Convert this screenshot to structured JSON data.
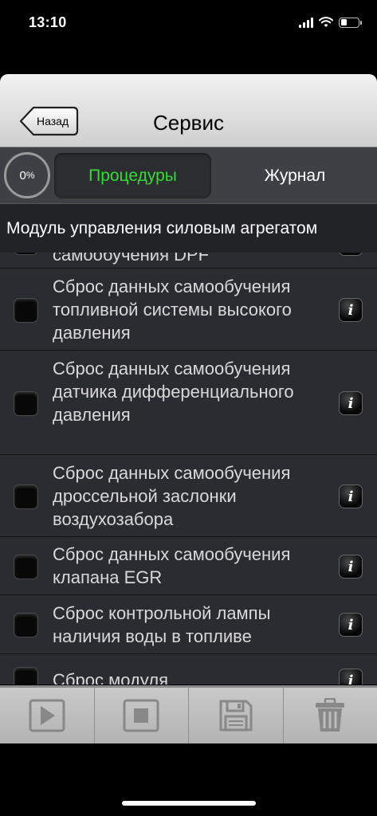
{
  "status": {
    "time": "13:10",
    "battery_level": 0.35
  },
  "nav": {
    "back_label": "Назад",
    "title": "Сервис"
  },
  "segments": {
    "progress_value": "0",
    "progress_unit": "%",
    "active_tab": "Процедуры",
    "other_tab": "Журнал"
  },
  "module_header": "Модуль управления силовым агрегатом",
  "procedures": [
    {
      "label": "самообучения DPF"
    },
    {
      "label": "Сброс данных самообучения топливной системы высокого давления"
    },
    {
      "label": "Сброс данных самообучения датчика дифференциального давления"
    },
    {
      "label": "Сброс данных самообучения дроссельной заслонки воздухозабора"
    },
    {
      "label": "Сброс данных самообучения клапана EGR"
    },
    {
      "label": "Сброс контрольной лампы наличия воды в топливе"
    },
    {
      "label": "Сброс модуля"
    }
  ],
  "info_glyph": "i",
  "toolbar": {
    "icons": [
      "play-icon",
      "stop-icon",
      "save-icon",
      "trash-icon"
    ]
  }
}
